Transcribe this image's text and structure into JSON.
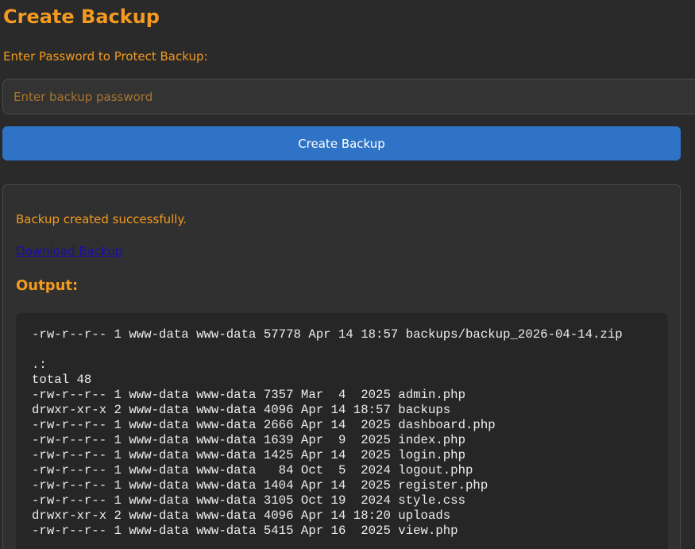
{
  "page": {
    "title": "Create Backup"
  },
  "form": {
    "password_label": "Enter Password to Protect Backup:",
    "password_placeholder": "Enter backup password",
    "password_value": "",
    "submit_label": "Create Backup"
  },
  "result": {
    "message": "Backup created successfully.",
    "download_label": "Download Backup",
    "output_heading": "Output:",
    "output_text": "-rw-r--r-- 1 www-data www-data 57778 Apr 14 18:57 backups/backup_2026-04-14.zip\n\n.:\ntotal 48\n-rw-r--r-- 1 www-data www-data 7357 Mar  4  2025 admin.php\ndrwxr-xr-x 2 www-data www-data 4096 Apr 14 18:57 backups\n-rw-r--r-- 1 www-data www-data 2666 Apr 14  2025 dashboard.php\n-rw-r--r-- 1 www-data www-data 1639 Apr  9  2025 index.php\n-rw-r--r-- 1 www-data www-data 1425 Apr 14  2025 login.php\n-rw-r--r-- 1 www-data www-data   84 Oct  5  2024 logout.php\n-rw-r--r-- 1 www-data www-data 1404 Apr 14  2025 register.php\n-rw-r--r-- 1 www-data www-data 3105 Oct 19  2024 style.css\ndrwxr-xr-x 2 www-data www-data 4096 Apr 14 18:20 uploads\n-rw-r--r-- 1 www-data www-data 5415 Apr 16  2025 view.php"
  },
  "colors": {
    "background": "#2a2a2a",
    "accent_orange": "#f39a1f",
    "button_blue": "#2e73c6",
    "link_blue": "#1a0dab",
    "output_background": "#262626"
  }
}
